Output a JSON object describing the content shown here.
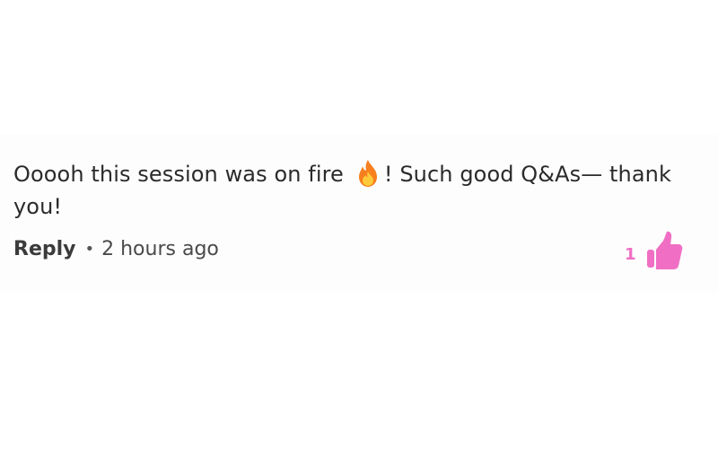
{
  "comment": {
    "text_before_icon": "Ooooh this session was on fire",
    "icon": "fire-emoji-icon",
    "text_after_icon": "! Such good Q&As— thank you!",
    "reply_label": "Reply",
    "separator": "•",
    "timestamp": "2 hours ago",
    "like_count": "1",
    "like_icon": "thumbs-up-icon"
  },
  "colors": {
    "accent": "#f06ec4",
    "text": "#2b2b2b",
    "fire_outer": "#f77f1e",
    "fire_inner": "#ffc93a"
  }
}
